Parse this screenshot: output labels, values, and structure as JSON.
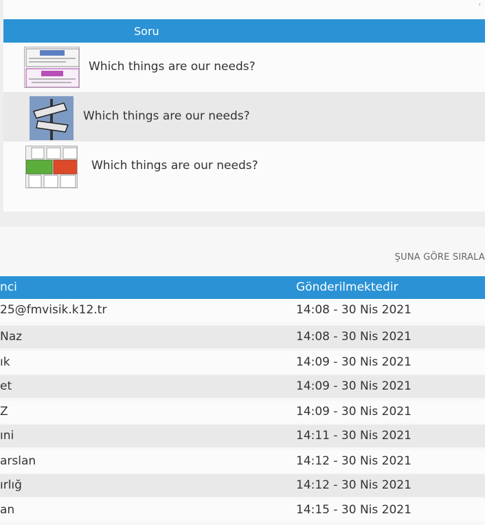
{
  "questions_panel": {
    "header": "Soru",
    "rows": [
      {
        "text": "Which things are our needs?",
        "thumbnail_icon": "needs-chart-icon"
      },
      {
        "text": "Which things are our needs?",
        "thumbnail_icon": "needs-wants-sign-icon"
      },
      {
        "text": "Which things are our needs?",
        "thumbnail_icon": "keyboard-needs-wants-icon"
      }
    ]
  },
  "submissions": {
    "sort_label": "ŞUNA GÖRE SIRALA",
    "columns": [
      "nci",
      "Gönderilmektedir"
    ],
    "rows": [
      {
        "student": "25@fmvisik.k12.tr",
        "sent": "14:08 - 30 Nis 2021"
      },
      {
        "student": "Naz",
        "sent": "14:08 - 30 Nis 2021"
      },
      {
        "student": "ık",
        "sent": "14:09 - 30 Nis 2021"
      },
      {
        "student": "et",
        "sent": "14:09 - 30 Nis 2021"
      },
      {
        "student": "Z",
        "sent": "14:09 - 30 Nis 2021"
      },
      {
        "student": "ıni",
        "sent": "14:11 - 30 Nis 2021"
      },
      {
        "student": "arslan",
        "sent": "14:12 - 30 Nis 2021"
      },
      {
        "student": "ırlığ",
        "sent": "14:12 - 30 Nis 2021"
      },
      {
        "student": "an",
        "sent": "14:15 - 30 Nis 2021"
      }
    ]
  },
  "colors": {
    "accent": "#2a92d5",
    "row_alt": "#e9e9e9",
    "row": "#fbfbfb"
  }
}
